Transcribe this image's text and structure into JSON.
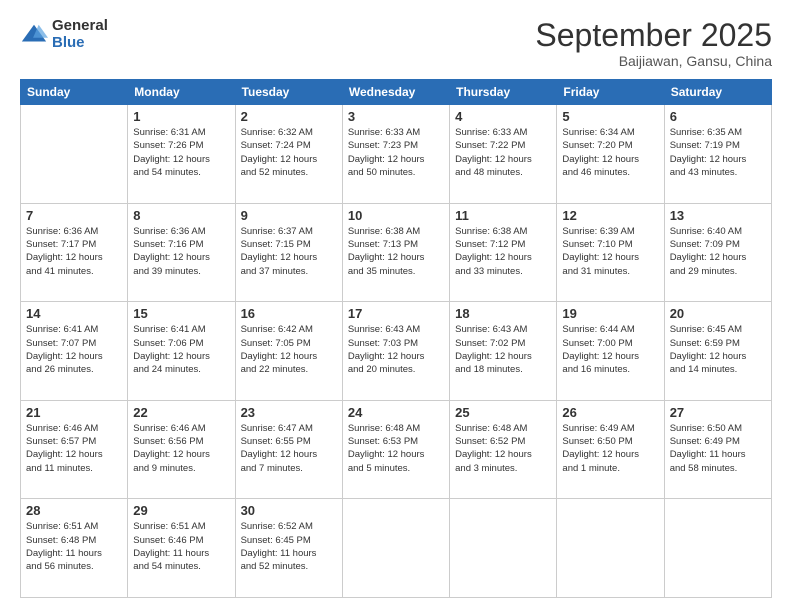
{
  "logo": {
    "general": "General",
    "blue": "Blue"
  },
  "header": {
    "month": "September 2025",
    "location": "Baijiawan, Gansu, China"
  },
  "weekdays": [
    "Sunday",
    "Monday",
    "Tuesday",
    "Wednesday",
    "Thursday",
    "Friday",
    "Saturday"
  ],
  "weeks": [
    [
      {
        "day": "",
        "info": ""
      },
      {
        "day": "1",
        "info": "Sunrise: 6:31 AM\nSunset: 7:26 PM\nDaylight: 12 hours\nand 54 minutes."
      },
      {
        "day": "2",
        "info": "Sunrise: 6:32 AM\nSunset: 7:24 PM\nDaylight: 12 hours\nand 52 minutes."
      },
      {
        "day": "3",
        "info": "Sunrise: 6:33 AM\nSunset: 7:23 PM\nDaylight: 12 hours\nand 50 minutes."
      },
      {
        "day": "4",
        "info": "Sunrise: 6:33 AM\nSunset: 7:22 PM\nDaylight: 12 hours\nand 48 minutes."
      },
      {
        "day": "5",
        "info": "Sunrise: 6:34 AM\nSunset: 7:20 PM\nDaylight: 12 hours\nand 46 minutes."
      },
      {
        "day": "6",
        "info": "Sunrise: 6:35 AM\nSunset: 7:19 PM\nDaylight: 12 hours\nand 43 minutes."
      }
    ],
    [
      {
        "day": "7",
        "info": "Sunrise: 6:36 AM\nSunset: 7:17 PM\nDaylight: 12 hours\nand 41 minutes."
      },
      {
        "day": "8",
        "info": "Sunrise: 6:36 AM\nSunset: 7:16 PM\nDaylight: 12 hours\nand 39 minutes."
      },
      {
        "day": "9",
        "info": "Sunrise: 6:37 AM\nSunset: 7:15 PM\nDaylight: 12 hours\nand 37 minutes."
      },
      {
        "day": "10",
        "info": "Sunrise: 6:38 AM\nSunset: 7:13 PM\nDaylight: 12 hours\nand 35 minutes."
      },
      {
        "day": "11",
        "info": "Sunrise: 6:38 AM\nSunset: 7:12 PM\nDaylight: 12 hours\nand 33 minutes."
      },
      {
        "day": "12",
        "info": "Sunrise: 6:39 AM\nSunset: 7:10 PM\nDaylight: 12 hours\nand 31 minutes."
      },
      {
        "day": "13",
        "info": "Sunrise: 6:40 AM\nSunset: 7:09 PM\nDaylight: 12 hours\nand 29 minutes."
      }
    ],
    [
      {
        "day": "14",
        "info": "Sunrise: 6:41 AM\nSunset: 7:07 PM\nDaylight: 12 hours\nand 26 minutes."
      },
      {
        "day": "15",
        "info": "Sunrise: 6:41 AM\nSunset: 7:06 PM\nDaylight: 12 hours\nand 24 minutes."
      },
      {
        "day": "16",
        "info": "Sunrise: 6:42 AM\nSunset: 7:05 PM\nDaylight: 12 hours\nand 22 minutes."
      },
      {
        "day": "17",
        "info": "Sunrise: 6:43 AM\nSunset: 7:03 PM\nDaylight: 12 hours\nand 20 minutes."
      },
      {
        "day": "18",
        "info": "Sunrise: 6:43 AM\nSunset: 7:02 PM\nDaylight: 12 hours\nand 18 minutes."
      },
      {
        "day": "19",
        "info": "Sunrise: 6:44 AM\nSunset: 7:00 PM\nDaylight: 12 hours\nand 16 minutes."
      },
      {
        "day": "20",
        "info": "Sunrise: 6:45 AM\nSunset: 6:59 PM\nDaylight: 12 hours\nand 14 minutes."
      }
    ],
    [
      {
        "day": "21",
        "info": "Sunrise: 6:46 AM\nSunset: 6:57 PM\nDaylight: 12 hours\nand 11 minutes."
      },
      {
        "day": "22",
        "info": "Sunrise: 6:46 AM\nSunset: 6:56 PM\nDaylight: 12 hours\nand 9 minutes."
      },
      {
        "day": "23",
        "info": "Sunrise: 6:47 AM\nSunset: 6:55 PM\nDaylight: 12 hours\nand 7 minutes."
      },
      {
        "day": "24",
        "info": "Sunrise: 6:48 AM\nSunset: 6:53 PM\nDaylight: 12 hours\nand 5 minutes."
      },
      {
        "day": "25",
        "info": "Sunrise: 6:48 AM\nSunset: 6:52 PM\nDaylight: 12 hours\nand 3 minutes."
      },
      {
        "day": "26",
        "info": "Sunrise: 6:49 AM\nSunset: 6:50 PM\nDaylight: 12 hours\nand 1 minute."
      },
      {
        "day": "27",
        "info": "Sunrise: 6:50 AM\nSunset: 6:49 PM\nDaylight: 11 hours\nand 58 minutes."
      }
    ],
    [
      {
        "day": "28",
        "info": "Sunrise: 6:51 AM\nSunset: 6:48 PM\nDaylight: 11 hours\nand 56 minutes."
      },
      {
        "day": "29",
        "info": "Sunrise: 6:51 AM\nSunset: 6:46 PM\nDaylight: 11 hours\nand 54 minutes."
      },
      {
        "day": "30",
        "info": "Sunrise: 6:52 AM\nSunset: 6:45 PM\nDaylight: 11 hours\nand 52 minutes."
      },
      {
        "day": "",
        "info": ""
      },
      {
        "day": "",
        "info": ""
      },
      {
        "day": "",
        "info": ""
      },
      {
        "day": "",
        "info": ""
      }
    ]
  ]
}
